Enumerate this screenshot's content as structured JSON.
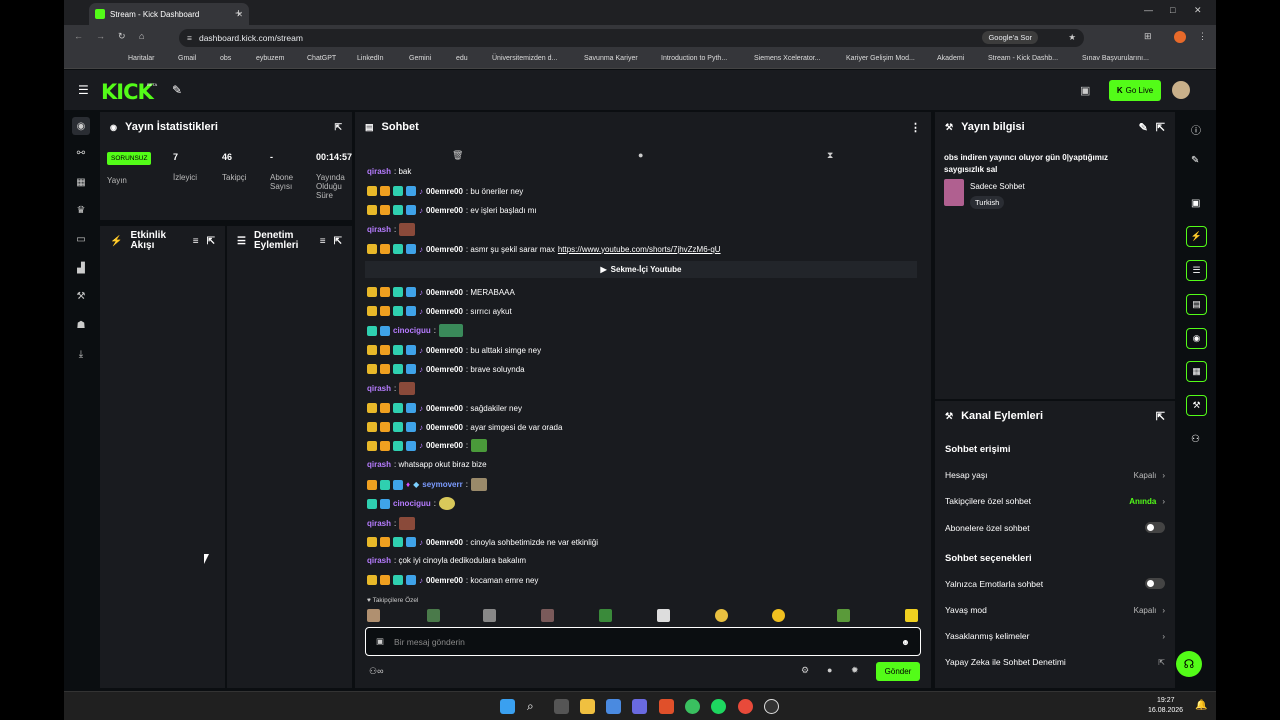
{
  "browser": {
    "tab_title": "Stream - Kick Dashboard",
    "url": "dashboard.kick.com/stream",
    "google_btn": "Google'a Sor",
    "bookmarks": [
      "Haritalar",
      "Gmail",
      "obs",
      "eybuzem",
      "ChatGPT",
      "LinkedIn",
      "Gemini",
      "edu",
      "Üniversitemizden d...",
      "Savunma Kariyer",
      "Introduction to Pyth...",
      "Siemens Xcelerator...",
      "Kariyer Gelişim Mod...",
      "Akademi",
      "Stream - Kick Dashb...",
      "Sınav Başvurularını..."
    ]
  },
  "header": {
    "logo": "KICK",
    "beta": "BETA",
    "golive": "Go Live"
  },
  "stats": {
    "title": "Yayın İstatistikleri",
    "badge": "SORUNSUZ",
    "badge_label": "Yayın",
    "viewers": "7",
    "viewers_label": "İzleyici",
    "followers": "46",
    "followers_label": "Takipçi",
    "subs": "-",
    "subs_label": "Abone Sayısı",
    "uptime": "00:14:57",
    "uptime_label": "Yayında Olduğu Süre"
  },
  "activity": {
    "title": "Etkinlik Akışı"
  },
  "moderation": {
    "title": "Denetim Eylemleri"
  },
  "chat": {
    "title": "Sohbet",
    "top_msg_user": "qirash",
    "top_msg_text": ": bak",
    "messages": [
      {
        "user": "00emre00",
        "text": ": bu öneriler ney"
      },
      {
        "user": "00emre00",
        "text": ": ev işleri başladı mı"
      },
      {
        "user": "qirash",
        "text": ":"
      },
      {
        "user": "00emre00",
        "text": ": asmr şu şekil sarar max ",
        "link": "https://www.youtube.com/shorts/7jhvZzM6-qU"
      },
      {
        "user": "00emre00",
        "text": ": MERABAAA"
      },
      {
        "user": "00emre00",
        "text": ": sırrıcı aykut"
      },
      {
        "user": "cinociguu",
        "text": ":"
      },
      {
        "user": "00emre00",
        "text": ": bu alttaki simge ney"
      },
      {
        "user": "00emre00",
        "text": ": brave soluynda"
      },
      {
        "user": "qirash",
        "text": ":"
      },
      {
        "user": "00emre00",
        "text": ": sağdakiler ney"
      },
      {
        "user": "00emre00",
        "text": ": ayar simgesi de var orada"
      },
      {
        "user": "00emre00",
        "text": ":"
      },
      {
        "user": "qirash",
        "text": ": whatsapp okut biraz bize"
      },
      {
        "user": "seymoverr",
        "text": ":"
      },
      {
        "user": "cinociguu",
        "text": ":"
      },
      {
        "user": "qirash",
        "text": ":"
      },
      {
        "user": "00emre00",
        "text": ": cinoyla sohbetimizde ne var etkinliği"
      },
      {
        "user": "qirash",
        "text": ": çok iyi cinoyla dedikodulara bakalım"
      },
      {
        "user": "00emre00",
        "text": ": kocaman emre ney"
      }
    ],
    "divider": "Sekme-İçi Youtube",
    "followers_only": "Takipçilere Özel",
    "placeholder": "Bir mesaj gönderin",
    "send": "Gönder"
  },
  "stream_info": {
    "title": "Yayın bilgisi",
    "stream_title": "obs indiren yayıncı oluyor gün 0|yaptığımız saygısızlık sal",
    "category": "Sadece Sohbet",
    "language": "Turkish"
  },
  "channel": {
    "title": "Kanal Eylemleri",
    "section1": "Sohbet erişimi",
    "account_age": "Hesap yaşı",
    "account_age_val": "Kapalı",
    "followers_only": "Takipçilere özel sohbet",
    "followers_only_val": "Anında",
    "subs_only": "Abonelere özel sohbet",
    "section2": "Sohbet seçenekleri",
    "emotes_only": "Yalnızca Emotlarla sohbet",
    "slow_mode": "Yavaş mod",
    "slow_mode_val": "Kapalı",
    "banned_words": "Yasaklanmış kelimeler",
    "ai_mod": "Yapay Zeka ile Sohbet Denetimi"
  },
  "taskbar": {
    "time": "19:27",
    "date": "16.08.2026"
  },
  "colors": {
    "accent": "#53fc18",
    "bg": "#0b0e11",
    "panel": "#191b1f",
    "purple": "#b67cff"
  }
}
